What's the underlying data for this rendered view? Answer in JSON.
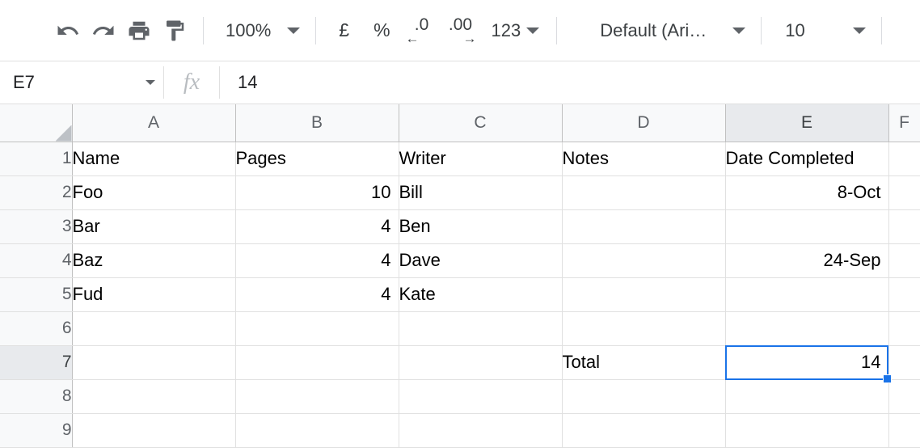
{
  "toolbar": {
    "undo": "undo-arrow",
    "redo": "redo-arrow",
    "print": "printer",
    "paint_format": "paint-roller",
    "zoom_level": "100%",
    "currency_symbol": "£",
    "percent_symbol": "%",
    "decrease_decimal": ".0",
    "increase_decimal": ".00",
    "decrease_arrow": "←",
    "increase_arrow": "→",
    "number_format": "123",
    "font_name": "Default (Ari…",
    "font_size": "10"
  },
  "formula_bar": {
    "name_box": "E7",
    "fx_label": "fx",
    "content": "14"
  },
  "grid": {
    "columns": [
      "A",
      "B",
      "C",
      "D",
      "E",
      "F"
    ],
    "selected_column": "E",
    "selected_row": "7",
    "selected_cell": "E7",
    "rows": [
      {
        "num": "1",
        "cells": [
          "Name",
          "Pages",
          "Writer",
          "Notes",
          "Date Completed",
          ""
        ]
      },
      {
        "num": "2",
        "cells": [
          "Foo",
          "10",
          "Bill",
          "",
          "8-Oct",
          ""
        ]
      },
      {
        "num": "3",
        "cells": [
          "Bar",
          "4",
          "Ben",
          "",
          "",
          ""
        ]
      },
      {
        "num": "4",
        "cells": [
          "Baz",
          "4",
          "Dave",
          "",
          "24-Sep",
          ""
        ]
      },
      {
        "num": "5",
        "cells": [
          "Fud",
          "4",
          "Kate",
          "",
          "",
          ""
        ]
      },
      {
        "num": "6",
        "cells": [
          "",
          "",
          "",
          "",
          "",
          ""
        ]
      },
      {
        "num": "7",
        "cells": [
          "",
          "",
          "",
          "Total",
          "14",
          ""
        ]
      },
      {
        "num": "8",
        "cells": [
          "",
          "",
          "",
          "",
          "",
          ""
        ]
      },
      {
        "num": "9",
        "cells": [
          "",
          "",
          "",
          "",
          "",
          ""
        ]
      }
    ],
    "align": [
      [
        "left",
        "left",
        "left",
        "left",
        "left",
        "left"
      ],
      [
        "left",
        "right",
        "left",
        "left",
        "right",
        "left"
      ],
      [
        "left",
        "right",
        "left",
        "left",
        "right",
        "left"
      ],
      [
        "left",
        "right",
        "left",
        "left",
        "right",
        "left"
      ],
      [
        "left",
        "right",
        "left",
        "left",
        "right",
        "left"
      ],
      [
        "left",
        "left",
        "left",
        "left",
        "left",
        "left"
      ],
      [
        "left",
        "left",
        "left",
        "left",
        "right",
        "left"
      ],
      [
        "left",
        "left",
        "left",
        "left",
        "left",
        "left"
      ],
      [
        "left",
        "left",
        "left",
        "left",
        "left",
        "left"
      ]
    ]
  },
  "colors": {
    "accent": "#1a73e8",
    "header_bg": "#f8f9fa",
    "header_selected_bg": "#e8eaed",
    "gridline": "#e0e0e0",
    "icon": "#5f6368"
  }
}
